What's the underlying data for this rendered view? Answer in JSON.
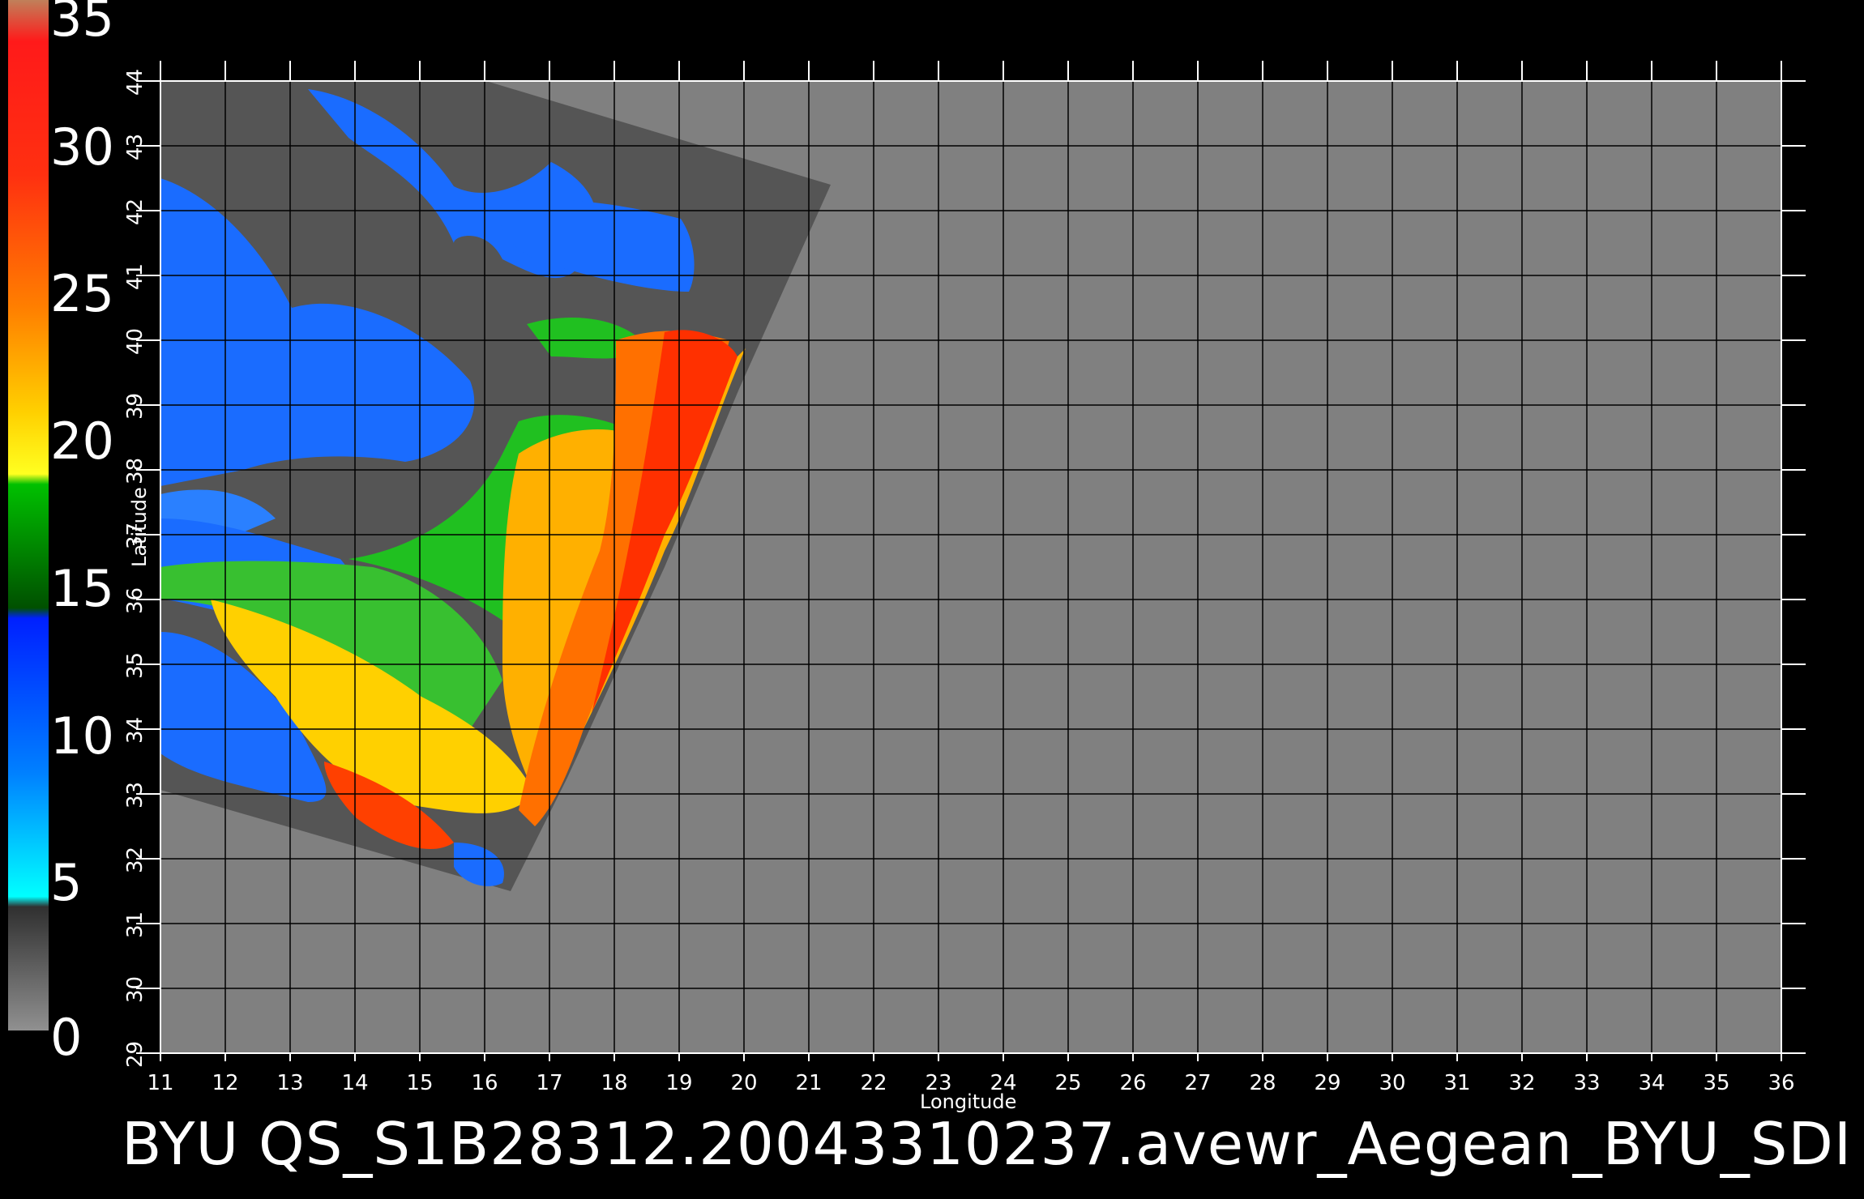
{
  "caption": "BYU  QS_S1B28312.20043310237.avewr_Aegean_BYU_SDI",
  "axes": {
    "xlabel": "Longitude",
    "ylabel": "Latitude",
    "x_ticks": [
      "11",
      "12",
      "13",
      "14",
      "15",
      "16",
      "17",
      "18",
      "19",
      "20",
      "21",
      "22",
      "23",
      "24",
      "25",
      "26",
      "27",
      "28",
      "29",
      "30",
      "31",
      "32",
      "33",
      "34",
      "35",
      "36"
    ],
    "y_ticks": [
      "29",
      "30",
      "31",
      "32",
      "33",
      "34",
      "35",
      "36",
      "37",
      "38",
      "39",
      "40",
      "41",
      "42",
      "43",
      "44"
    ],
    "xlim": [
      11,
      36
    ],
    "ylim": [
      29,
      44
    ]
  },
  "colorbar": {
    "labels": [
      "35",
      "30",
      "25",
      "20",
      "15",
      "10",
      "5",
      "0"
    ],
    "range": [
      0,
      35
    ],
    "colors": [
      "#c0805a",
      "#ff1010",
      "#ff5010",
      "#ffc000",
      "#ffff00",
      "#00d000",
      "#0040ff",
      "#00ffff",
      "#404040",
      "#808080"
    ]
  },
  "map_colors": {
    "background": "#000000",
    "no_data": "#808080",
    "swath_land": "#555555",
    "low_wind": "#1a6cff",
    "mid_wind": "#20c020",
    "high_wind": "#ffd000",
    "very_high_wind": "#ff4000",
    "grid": "#000000"
  }
}
